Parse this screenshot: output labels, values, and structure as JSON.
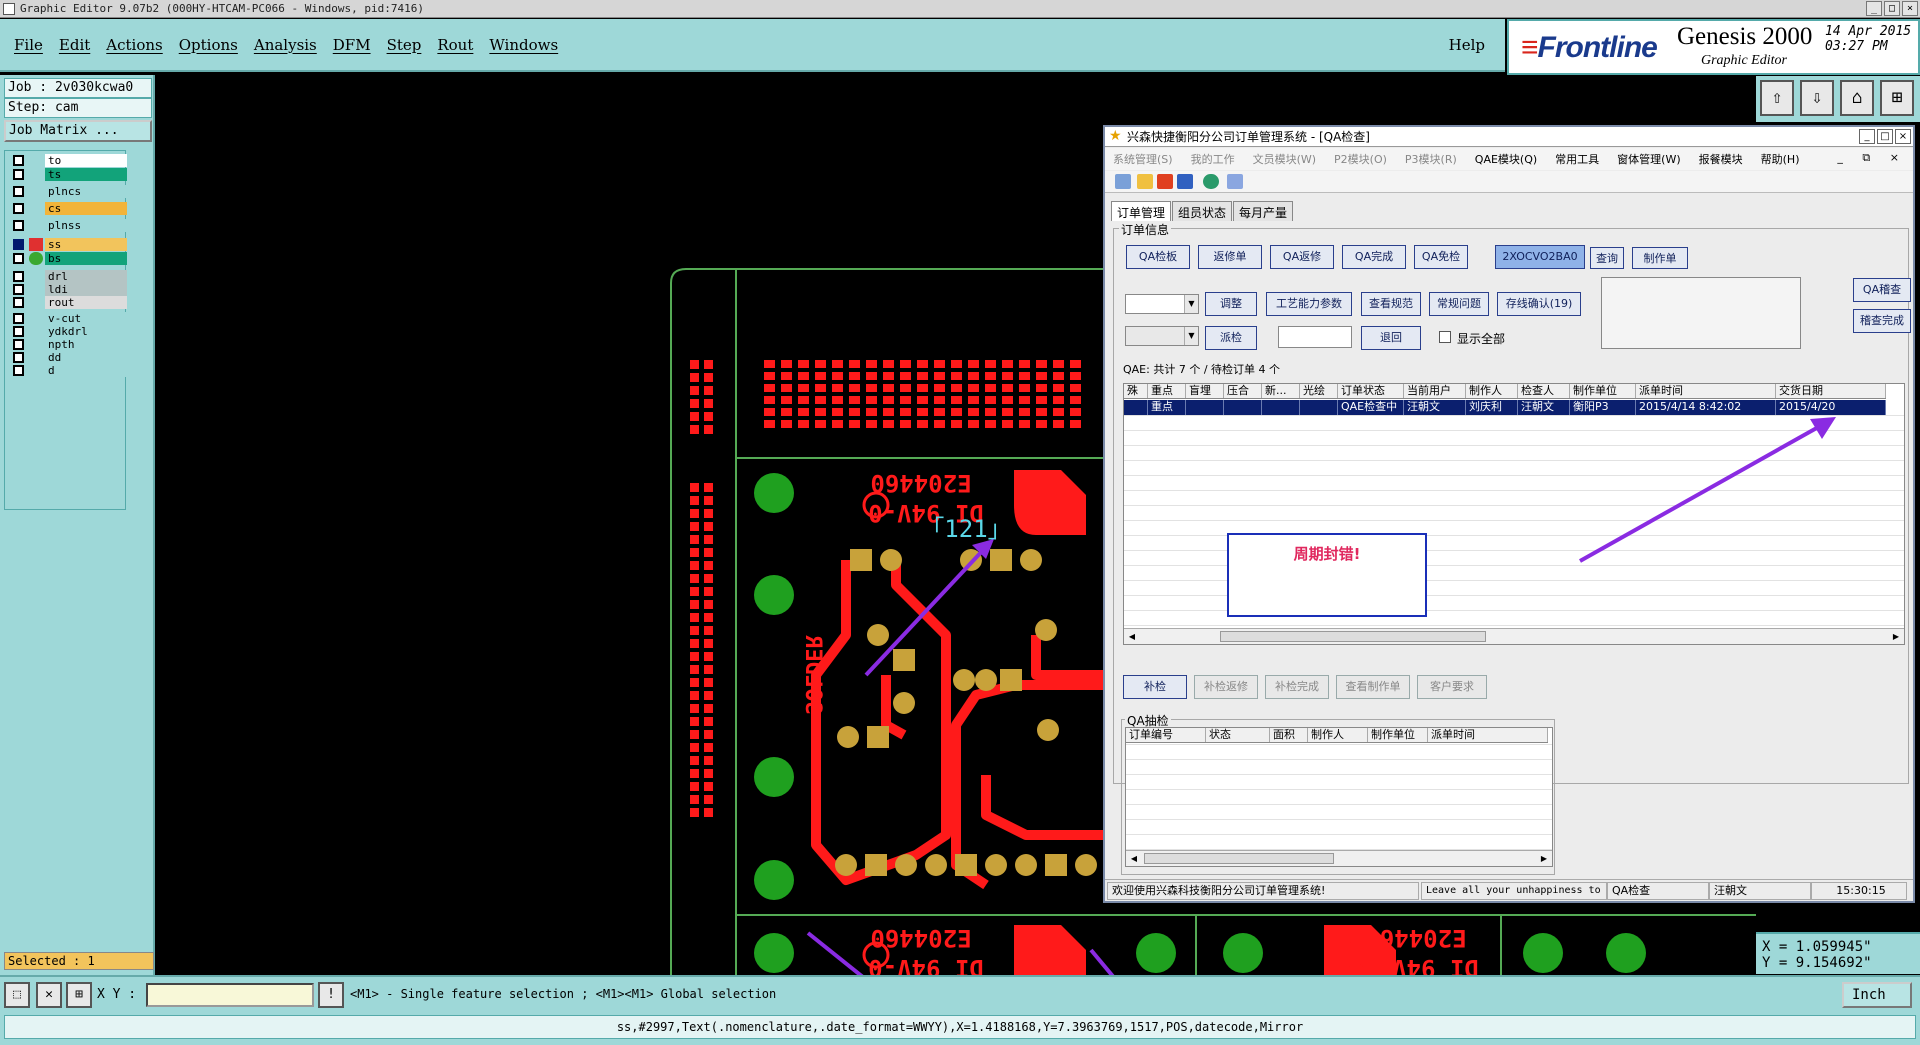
{
  "titlebar": {
    "text": "Graphic Editor 9.07b2 (000HY-HTCAM-PC066 - Windows, pid:7416)",
    "btn_min": "_",
    "btn_max": "□",
    "btn_close": "×"
  },
  "menu": {
    "items": [
      "File",
      "Edit",
      "Actions",
      "Options",
      "Analysis",
      "DFM",
      "Step",
      "Rout",
      "Windows"
    ],
    "help": "Help"
  },
  "brand": {
    "logo": "Frontline",
    "product": "Genesis 2000",
    "subtitle": "Graphic Editor",
    "date": "14 Apr 2015",
    "time": "03:27 PM"
  },
  "left": {
    "job": "Job : 2v030kcwa0",
    "step": "Step: cam",
    "job_matrix": "Job Matrix ...",
    "layers": [
      {
        "name": "to",
        "color": "#ffffff",
        "active": false
      },
      {
        "name": "ts",
        "color": "#12a37a",
        "active": false
      },
      {
        "name": "plncs",
        "color": "#9ed8d8",
        "active": false
      },
      {
        "name": "cs",
        "color": "#f2b43a",
        "active": false
      },
      {
        "name": "plnss",
        "color": "#9ed8d8",
        "active": false
      },
      {
        "name": "ss",
        "color": "#f2c45c",
        "active": true
      },
      {
        "name": "bs",
        "color": "#12a37a",
        "active": false
      },
      {
        "name": "drl",
        "color": "#b4c4c4",
        "active": false
      },
      {
        "name": "ldi",
        "color": "#b4c4c4",
        "active": false
      },
      {
        "name": "rout",
        "color": "#dcdcdc",
        "active": false
      },
      {
        "name": "v-cut",
        "color": "#9ed8d8",
        "active": false
      },
      {
        "name": "ydkdrl",
        "color": "#9ed8d8",
        "active": false
      },
      {
        "name": "npth",
        "color": "#9ed8d8",
        "active": false
      },
      {
        "name": "dd",
        "color": "#9ed8d8",
        "active": false
      },
      {
        "name": "d",
        "color": "#9ed8d8",
        "active": false
      }
    ],
    "selected": "Selected : 1"
  },
  "canvas": {
    "board_text": "E204460",
    "board_text2": "DI 94V-0",
    "date_code": "「121」",
    "solder_text": "SOLDER",
    "trace_color": "#ff1a1a",
    "pad_color": "#c8a23a",
    "via_color": "#1fa01f",
    "outline_color": "#55aa55",
    "arrow_color": "#8a2be2"
  },
  "coords": {
    "x": "X = 1.059945\"",
    "y": "Y = 9.154692\""
  },
  "prompt": {
    "xy_label": "X Y :",
    "text": "<M1> - Single feature selection ; <M1><M1> Global selection",
    "unit": "Inch"
  },
  "status": "ss,#2997,Text(.nomenclature,.date_format=WWYY),X=1.4188168,Y=7.3963769,1517,POS,datecode,Mirror",
  "qa": {
    "title": "兴森快捷衡阳分公司订单管理系统 - [QA检查]",
    "menu": [
      {
        "label": "系统管理(S)",
        "on": false
      },
      {
        "label": "我的工作",
        "on": false
      },
      {
        "label": "文员模块(W)",
        "on": false
      },
      {
        "label": "P2模块(O)",
        "on": false
      },
      {
        "label": "P3模块(R)",
        "on": false
      },
      {
        "label": "QAE模块(Q)",
        "on": true
      },
      {
        "label": "常用工具",
        "on": true
      },
      {
        "label": "窗体管理(W)",
        "on": true
      },
      {
        "label": "报餐模块",
        "on": true
      },
      {
        "label": "帮助(H)",
        "on": true
      }
    ],
    "menu_end": "_ ⧉ ×",
    "tabs": [
      "订单管理",
      "组员状态",
      "每月产量"
    ],
    "group_order": "订单信息",
    "btn_row1": [
      "QA检板",
      "返修单",
      "QA返修",
      "QA完成",
      "QA免检"
    ],
    "order_code": "2XOCVO2BA0",
    "btn_query": "查询",
    "btn_make": "制作单",
    "btn_row2": [
      "调整",
      "工艺能力参数",
      "查看规范",
      "常规问题",
      "存线确认(19)"
    ],
    "btn_dispatch": "派检",
    "btn_return": "退回",
    "show_all": "显示全部",
    "btn_right1": "QA稽查",
    "btn_right2": "稽查完成",
    "summary": "QAE: 共计 7 个 / 待检订单 4 个",
    "grid_cols": [
      "殊",
      "重点",
      "盲埋",
      "压合",
      "新...",
      "光绘",
      "订单状态",
      "当前用户",
      "制作人",
      "检查人",
      "制作单位",
      "派单时间",
      "交货日期"
    ],
    "grid_row": [
      "",
      "重点",
      "",
      "",
      "",
      "",
      "QAE检查中",
      "汪朝文",
      "刘庆利",
      "汪朝文",
      "衡阳P3",
      "2015/4/14 8:42:02",
      "2015/4/20"
    ],
    "error_note": "周期封错!",
    "btn_row3": [
      "补检",
      "补检返修",
      "补检完成",
      "查看制作单",
      "客户要求"
    ],
    "group_sample": "QA抽检",
    "sample_cols": [
      "订单编号",
      "状态",
      "面积",
      "制作人",
      "制作单位",
      "派单时间"
    ],
    "status_welcome": "欢迎使用兴森科技衡阳分公司订单管理系统!",
    "status_motto": "Leave all your unhappiness to",
    "status_module": "QA检查",
    "status_user": "汪朝文",
    "status_time": "15:30:15"
  }
}
